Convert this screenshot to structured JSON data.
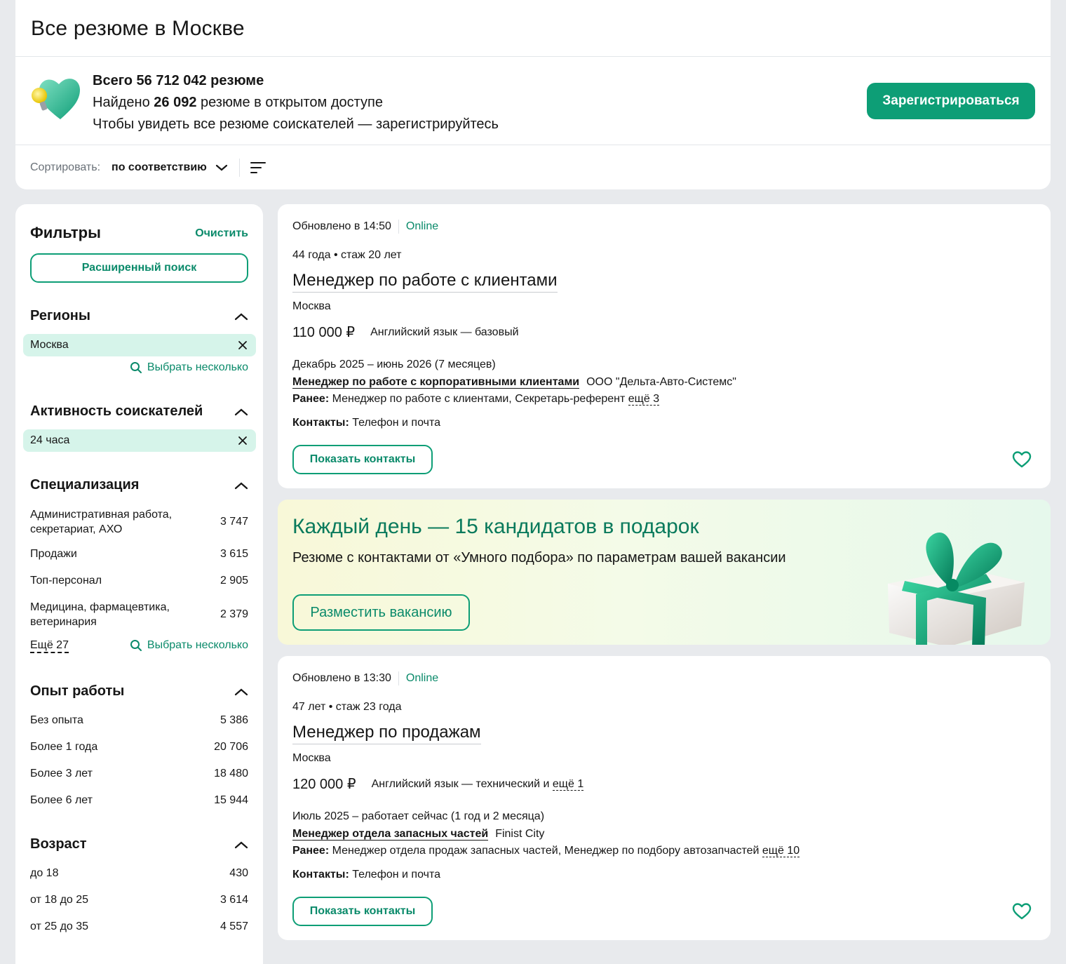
{
  "header": {
    "title": "Все резюме в Москве",
    "total_prefix": "Всего 56 712 042 резюме",
    "found_prefix": "Найдено ",
    "found_count": "26 092",
    "found_suffix": " резюме в открытом доступе",
    "register_hint": "Чтобы увидеть все резюме соискателей — зарегистрируйтесь",
    "register_button": "Зарегистрироваться",
    "sort_label": "Сортировать:",
    "sort_value": "по соответствию"
  },
  "filters": {
    "title": "Фильтры",
    "clear": "Очистить",
    "advanced_search": "Расширенный поиск",
    "regions": {
      "title": "Регионы",
      "chip": "Москва",
      "pick_many": "Выбрать несколько"
    },
    "activity": {
      "title": "Активность соискателей",
      "chip": "24 часа"
    },
    "specialization": {
      "title": "Специализация",
      "items": [
        {
          "label": "Административная работа, секретариат, АХО",
          "count": "3 747"
        },
        {
          "label": "Продажи",
          "count": "3 615"
        },
        {
          "label": "Топ-персонал",
          "count": "2 905"
        },
        {
          "label": "Медицина, фармацевтика, ветеринария",
          "count": "2 379"
        }
      ],
      "more": "Ещё 27",
      "pick_many": "Выбрать несколько"
    },
    "experience": {
      "title": "Опыт работы",
      "items": [
        {
          "label": "Без опыта",
          "count": "5 386"
        },
        {
          "label": "Более 1 года",
          "count": "20 706"
        },
        {
          "label": "Более 3 лет",
          "count": "18 480"
        },
        {
          "label": "Более 6 лет",
          "count": "15 944"
        }
      ]
    },
    "age": {
      "title": "Возраст",
      "items": [
        {
          "label": "до 18",
          "count": "430"
        },
        {
          "label": "от 18 до 25",
          "count": "3 614"
        },
        {
          "label": "от 25 до 35",
          "count": "4 557"
        }
      ]
    }
  },
  "resumes": [
    {
      "updated": "Обновлено в 14:50",
      "online": "Online",
      "age_exp": "44 года • стаж 20 лет",
      "title": "Менеджер по работе с клиентами",
      "city": "Москва",
      "salary": "110 000 ₽",
      "language": "Английский язык — базовый",
      "language_more": "",
      "period": "Декабрь 2025 – июнь 2026 (7 месяцев)",
      "position": "Менеджер по работе с корпоративными клиентами",
      "company": "ООО \"Дельта-Авто-Системс\"",
      "earlier_label": "Ранее:",
      "earlier": " Менеджер по работе с клиентами, Секретарь-референт ",
      "earlier_more": "ещё 3",
      "contacts_label": "Контакты:",
      "contacts": " Телефон и почта",
      "show_contacts": "Показать контакты"
    },
    {
      "updated": "Обновлено в 13:30",
      "online": "Online",
      "age_exp": "47 лет • стаж 23 года",
      "title": "Менеджер по продажам",
      "city": "Москва",
      "salary": "120 000 ₽",
      "language": "Английский язык — технический и ",
      "language_more": "ещё 1",
      "period": "Июль 2025 – работает сейчас (1 год и 2 месяца)",
      "position": "Менеджер отдела запасных частей",
      "company": "Finist City",
      "earlier_label": "Ранее:",
      "earlier": " Менеджер отдела продаж запасных частей, Менеджер по подбору автозапчастей ",
      "earlier_more": "ещё 10",
      "contacts_label": "Контакты:",
      "contacts": " Телефон и почта",
      "show_contacts": "Показать контакты"
    }
  ],
  "promo": {
    "title": "Каждый день — 15 кандидатов в подарок",
    "subtitle": "Резюме с контактами от «Умного подбора» по параметрам вашей вакансии",
    "button": "Разместить вакансию"
  },
  "colors": {
    "accent": "#0d9e76",
    "accent_text": "#0a8a6a",
    "chip_bg": "#d6f4ea"
  },
  "icons": [
    "heart-bulb-logo",
    "chevron-down-icon",
    "sort-lines-icon",
    "chevron-up-icon",
    "close-icon",
    "search-icon",
    "heart-outline-icon",
    "gift-icon"
  ]
}
